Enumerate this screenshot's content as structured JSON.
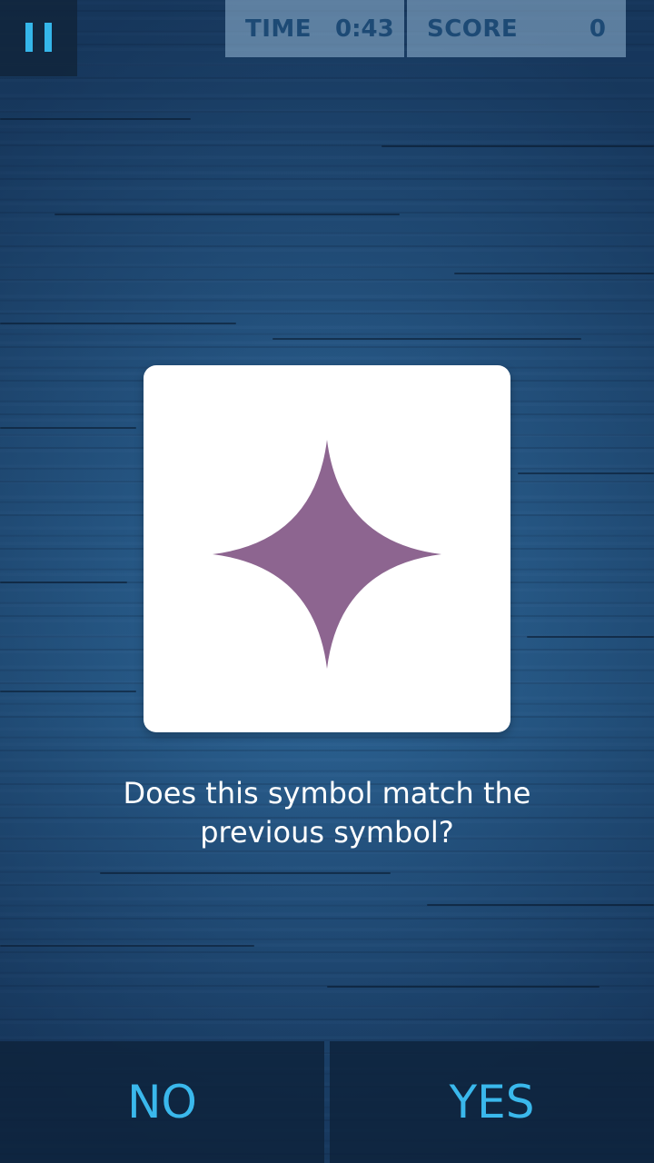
{
  "hud": {
    "time_label": "TIME",
    "time_value": "0:43",
    "score_label": "SCORE",
    "score_value": "0"
  },
  "card": {
    "symbol": "four-point-star",
    "symbol_color": "#8d6590"
  },
  "question": {
    "line1": "Does this symbol match the",
    "line2": "previous symbol?"
  },
  "buttons": {
    "no_label": "NO",
    "yes_label": "YES"
  },
  "colors": {
    "accent": "#35b6ea",
    "background": "#2d6596",
    "hud_text": "#1d4a75"
  }
}
